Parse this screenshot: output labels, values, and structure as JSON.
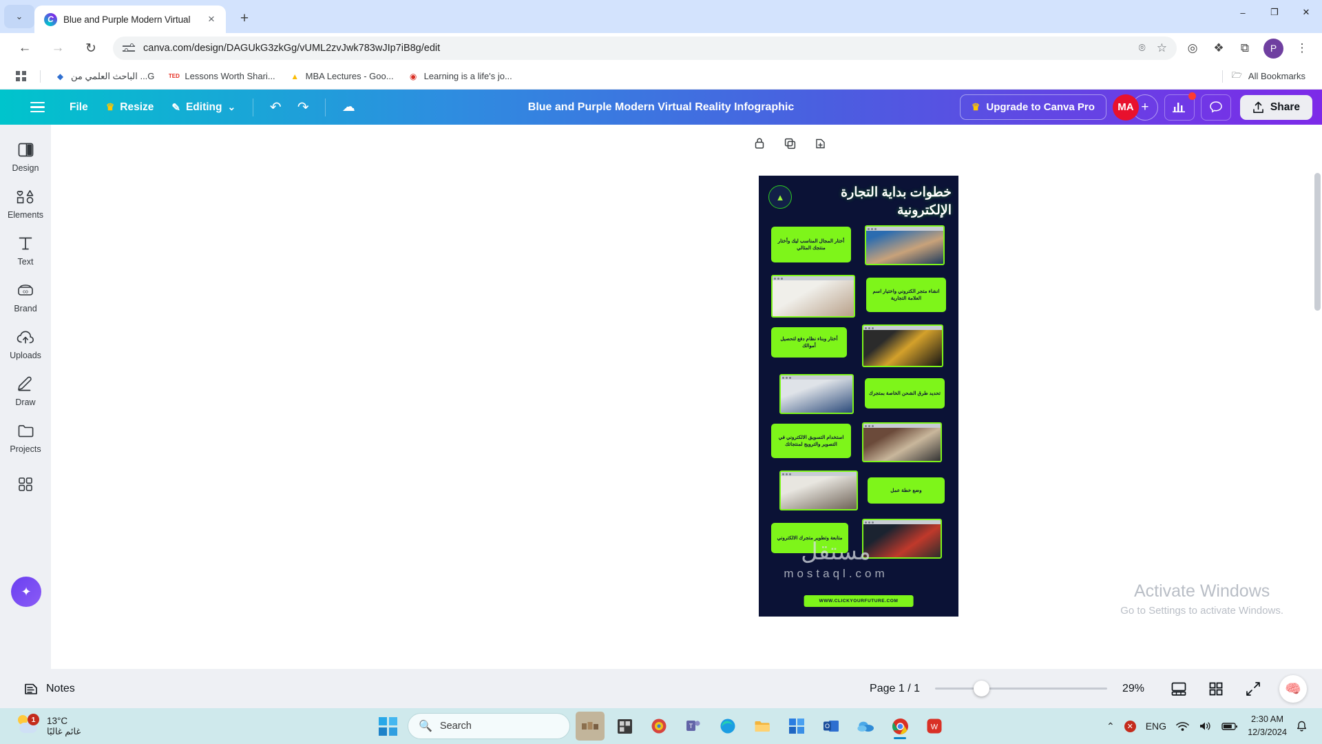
{
  "browser": {
    "tab": {
      "title": "Blue and Purple Modern Virtual",
      "favicon": "canva-icon",
      "close": "×"
    },
    "new_tab": "+",
    "tab_search": "⌄",
    "window_controls": {
      "minimize": "–",
      "maximize": "❐",
      "close": "✕"
    },
    "nav": {
      "back": "←",
      "forward": "→",
      "reload": "↻"
    },
    "url": "canva.com/design/DAGUkG3zkGg/vUML2zvJwk783wJIp7iB8g/edit",
    "url_right": {
      "incognito_eye": "⌾",
      "bookmark_star": "☆"
    },
    "extensions": {
      "ext1": "◎",
      "ext2": "❖",
      "puzzle": "⧉"
    },
    "profile_initial": "P",
    "menu": "⋮",
    "bookmarks": [
      {
        "label": "الباحث العلمي من ...G",
        "icon": "drive-blue-icon"
      },
      {
        "label": "Lessons Worth Shari...",
        "icon": "ted-icon"
      },
      {
        "label": "MBA Lectures - Goo...",
        "icon": "google-drive-icon"
      },
      {
        "label": "Learning is a life's jo...",
        "icon": "record-icon"
      }
    ],
    "all_bookmarks": "All Bookmarks"
  },
  "canva": {
    "menu_icon": "hamburger-icon",
    "file": "File",
    "resize": "Resize",
    "resize_crown": "♛",
    "editing": "Editing",
    "editing_caret": "⌄",
    "undo": "↶",
    "redo": "↷",
    "cloud_status": "cloud-check-icon",
    "doc_title": "Blue and Purple Modern Virtual Reality Infographic",
    "upgrade": "Upgrade to Canva Pro",
    "upgrade_crown": "♛",
    "avatar_initials": "MA",
    "add_people": "+",
    "insights_icon": "▐▐",
    "comment_icon": "◯",
    "share": "Share",
    "share_icon": "↑",
    "accent_gradient_start": "#00c4cc",
    "accent_gradient_end": "#7d2ae8",
    "avatar_color": "#e8112d"
  },
  "sidebar": {
    "items": [
      {
        "label": "Design",
        "icon": "design-panel-icon"
      },
      {
        "label": "Elements",
        "icon": "shapes-icon"
      },
      {
        "label": "Text",
        "icon": "text-t-icon"
      },
      {
        "label": "Brand",
        "icon": "brand-icon"
      },
      {
        "label": "Uploads",
        "icon": "upload-cloud-icon"
      },
      {
        "label": "Draw",
        "icon": "pencil-icon"
      },
      {
        "label": "Projects",
        "icon": "folder-icon"
      },
      {
        "label": "",
        "icon": "apps-grid-icon"
      }
    ],
    "ai_button": "magic-ai-icon"
  },
  "canvas": {
    "float_tools": [
      {
        "icon": "lock-icon"
      },
      {
        "icon": "duplicate-icon"
      },
      {
        "icon": "add-page-icon"
      }
    ],
    "design": {
      "title": "خطوات بداية التجارة الإلكترونية",
      "background": "#0b1236",
      "accent": "#7ef51a",
      "footer": "WWW.CLICKYOURFUTURE.COM",
      "steps": [
        {
          "text": "أختار المجال المناسب ليك وأختار منتجك المثالي",
          "side": "left"
        },
        {
          "text": "انشاء متجر الكتروني واختيار اسم العلامة التجارية",
          "side": "right"
        },
        {
          "text": "أختار وبناء نظام دفع لتحصيل أموالك",
          "side": "left"
        },
        {
          "text": "تحديد طرق الشحن الخاصة بمتجرك",
          "side": "right"
        },
        {
          "text": "استخدام التسويق الالكتروني في التصوير والترويج لمنتجاتك",
          "side": "left"
        },
        {
          "text": "وضع خطة عمل",
          "side": "right"
        },
        {
          "text": "متابعة وتطوير متجرك الالكتروني",
          "side": "left"
        }
      ]
    },
    "watermark": {
      "main": "مستقل",
      "sub": "mostaql.com"
    },
    "activate": {
      "line1": "Activate Windows",
      "line2": "Go to Settings to activate Windows."
    }
  },
  "bottom": {
    "notes": "Notes",
    "notes_icon": "notes-icon",
    "page_count": "Page 1 / 1",
    "zoom_value": "29%",
    "view_icons": [
      {
        "icon": "presenter-view-icon"
      },
      {
        "icon": "grid-view-icon"
      },
      {
        "icon": "fullscreen-icon"
      }
    ],
    "helper_icon": "brain-icon"
  },
  "taskbar": {
    "weather": {
      "temp": "13°C",
      "desc": "غائم غالبًا",
      "badge": "1"
    },
    "search_placeholder": "Search",
    "search_icon": "search-icon",
    "apps": [
      {
        "icon": "task-view-icon"
      },
      {
        "icon": "widgets-icon"
      },
      {
        "icon": "explorer-teams-icon"
      },
      {
        "icon": "edge-icon"
      },
      {
        "icon": "folder-icon"
      },
      {
        "icon": "store-icon"
      },
      {
        "icon": "outlook-icon"
      },
      {
        "icon": "onedrive-icon"
      },
      {
        "icon": "chrome-icon"
      },
      {
        "icon": "wps-icon"
      }
    ],
    "tray": {
      "chevron": "⌃",
      "error": "✕",
      "lang": "ENG",
      "wifi": "wifi-icon",
      "volume": "volume-icon",
      "battery": "battery-icon",
      "time": "2:30 AM",
      "date": "12/3/2024",
      "notif": "bell-icon"
    }
  }
}
